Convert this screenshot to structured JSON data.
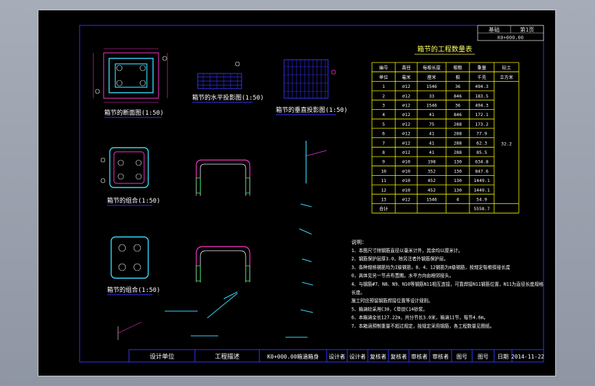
{
  "colors": {
    "background": "#000000",
    "frame": "#3333ff",
    "table": "#ffff00",
    "text_yellow": "#ffff66",
    "text_white": "#ffffff",
    "magenta": "#ff33cc",
    "cyan": "#33ddff",
    "green": "#33ff66",
    "red": "#ff3333"
  },
  "header_box": {
    "left": "基础",
    "right": "第1页",
    "number": "K0+000.00"
  },
  "drawings": {
    "section_title": "箱节的断面图(1:50)",
    "horizontal_title": "箱节的水平投影图(1:50)",
    "vertical_title": "箱节的垂直投影图(1:50)",
    "assembly1_title": "箱节的组合(1:50)",
    "assembly2_title": "箱节的组合(1:50)"
  },
  "table": {
    "title": "箱节的工程数量表",
    "headers_row1": [
      "编号",
      "直径",
      "每根长度",
      "根数",
      "重量",
      "砼工"
    ],
    "headers_row2": [
      "单位",
      "毫米",
      "厘米",
      "根",
      "千克",
      "立方米"
    ],
    "rows": [
      [
        "1",
        "⌀12",
        "1546",
        "36",
        "494.3"
      ],
      [
        "2",
        "⌀12",
        "33",
        "846",
        "183.5"
      ],
      [
        "3",
        "⌀12",
        "1546",
        "36",
        "494.3"
      ],
      [
        "4",
        "⌀12",
        "41",
        "846",
        "172.1"
      ],
      [
        "5",
        "⌀12",
        "75",
        "288",
        "173.2"
      ],
      [
        "6",
        "⌀12",
        "41",
        "288",
        "77.9"
      ],
      [
        "7",
        "⌀12",
        "41",
        "288",
        "62.3"
      ],
      [
        "8",
        "⌀12",
        "41",
        "288",
        "85.5"
      ],
      [
        "9",
        "⌀10",
        "198",
        "130",
        "634.8"
      ],
      [
        "10",
        "⌀10",
        "352",
        "130",
        "847.6"
      ],
      [
        "11",
        "⌀10",
        "452",
        "130",
        "1449.1"
      ],
      [
        "12",
        "⌀10",
        "452",
        "130",
        "1449.1"
      ],
      [
        "13",
        "⌀12",
        "1546",
        "4",
        "54.9"
      ]
    ],
    "concrete_value": "32.2",
    "total_label": "合计",
    "total_value": "5558.7"
  },
  "notes": {
    "title": "说明：",
    "lines": [
      "1、本图尺寸除钢筋直径以毫米计外，其余均以厘米计。",
      "2、钢筋保护层厚3.0，除另注者外钢筋保护层。",
      "3、各种规格钢筋均为I级钢筋，8、4、12钢筋为Ⅱ级钢筋，按规定每根搭接长度",
      "   0，具体见另一节点布置图。水平方向由相邻接头。",
      "4、与钢筋#7、N8、N9、N10等钢筋N11相互连接，可靠焊接N11钢筋位置，N11为直径长度规格",
      "   长度。",
      "施工时应预留钢筋焊接位置等设计规则。",
      "5、箱涵砼采用C30，C垫层C14砂浆。",
      "6、本箱涵全长127.22m，共分节长3.0米，箱涵11节，每节4.6m。",
      "7、本箱涵预制重量不超过规定，按规定采用钢筋，各工程数量见图纸。"
    ]
  },
  "title_block": {
    "design_unit": "设计单位",
    "project_desc": "工程描述",
    "drawing_name": "K0+000.00箱涵箱身",
    "designer": "设计者",
    "designer2": "设计者",
    "reviewer": "复核者",
    "reviewer2": "复核者",
    "auditor": "审核者",
    "auditor2": "审核者",
    "drawing_no_label": "图号",
    "drawing_no": "图号",
    "date_label": "日期",
    "date": "2014-11-22"
  }
}
